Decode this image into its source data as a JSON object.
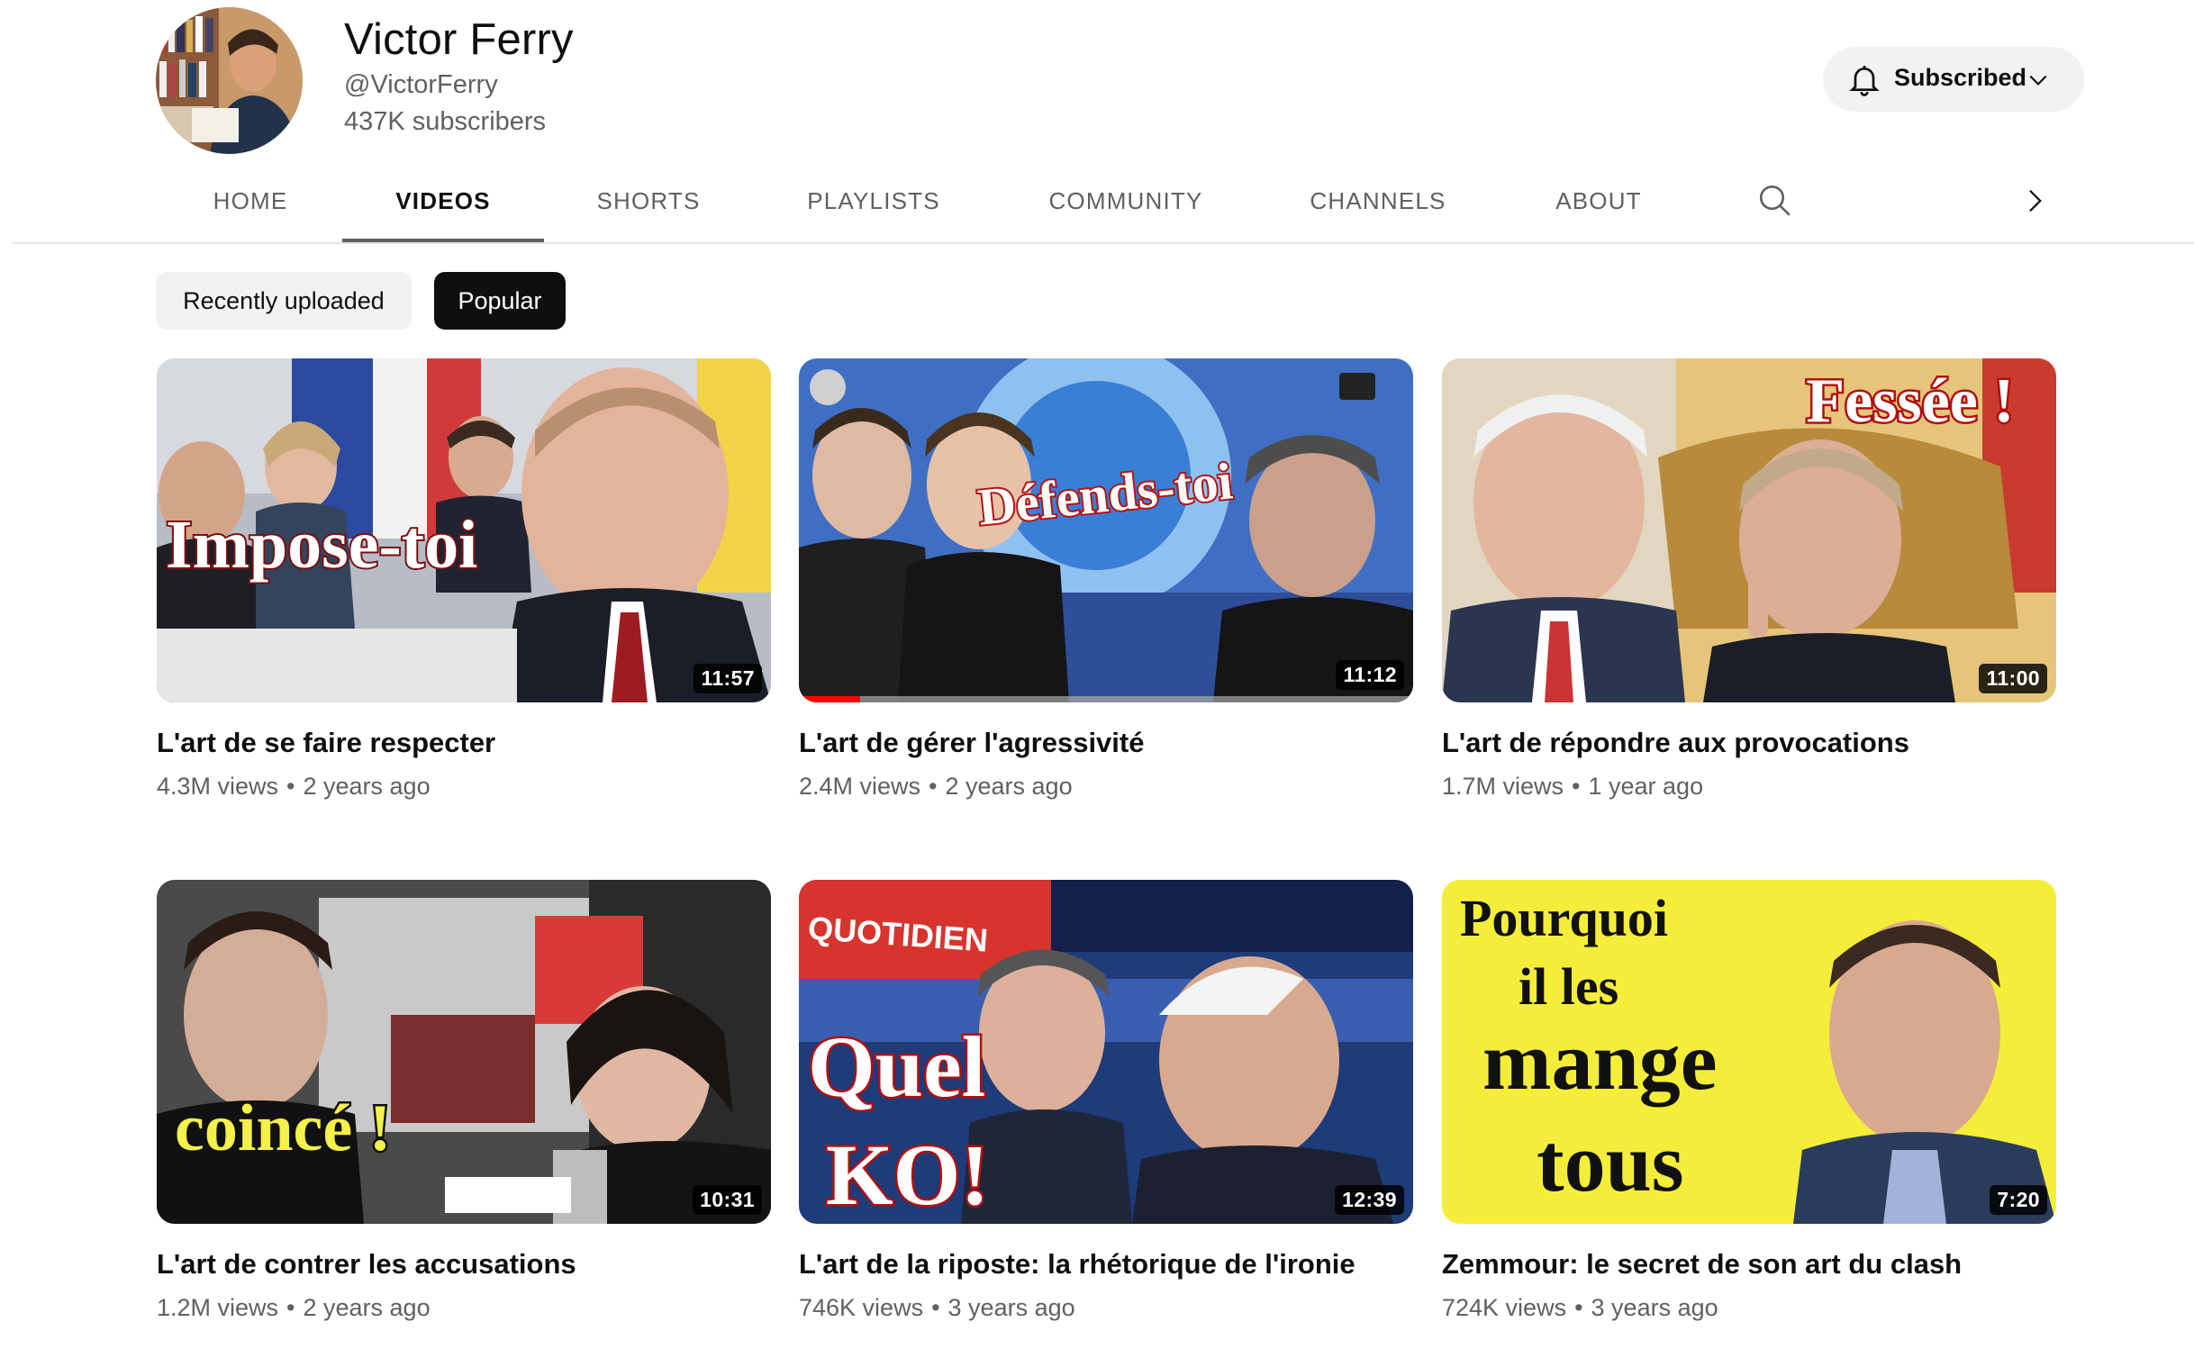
{
  "channel": {
    "name": "Victor Ferry",
    "handle": "@VictorFerry",
    "subscribers": "437K subscribers",
    "subscribe_label": "Subscribed"
  },
  "tabs": [
    {
      "label": "HOME",
      "active": false
    },
    {
      "label": "VIDEOS",
      "active": true
    },
    {
      "label": "SHORTS",
      "active": false
    },
    {
      "label": "PLAYLISTS",
      "active": false
    },
    {
      "label": "COMMUNITY",
      "active": false
    },
    {
      "label": "CHANNELS",
      "active": false
    },
    {
      "label": "ABOUT",
      "active": false
    }
  ],
  "icons": {
    "bell": "bell-icon",
    "chevron": "chevron-down-icon",
    "search": "search-icon",
    "next": "chevron-right-icon"
  },
  "chips": [
    {
      "label": "Recently uploaded",
      "active": false
    },
    {
      "label": "Popular",
      "active": true
    }
  ],
  "videos": [
    {
      "title": "L'art de se faire respecter",
      "views": "4.3M views",
      "age": "2 years ago",
      "duration": "11:57",
      "thumb_text": [
        "Impose-toi"
      ],
      "progress": 0
    },
    {
      "title": "L'art de gérer l'agressivité",
      "views": "2.4M views",
      "age": "2 years ago",
      "duration": "11:12",
      "thumb_text": [
        "Défends-toi"
      ],
      "progress": 0.1
    },
    {
      "title": "L'art de répondre aux provocations",
      "views": "1.7M views",
      "age": "1 year ago",
      "duration": "11:00",
      "thumb_text": [
        "Fessée !"
      ],
      "progress": 0
    },
    {
      "title": "L'art de contrer les accusations",
      "views": "1.2M views",
      "age": "2 years ago",
      "duration": "10:31",
      "thumb_text": [
        "coincé !"
      ],
      "progress": 0
    },
    {
      "title": "L'art de la riposte: la rhétorique de l'ironie",
      "views": "746K views",
      "age": "3 years ago",
      "duration": "12:39",
      "thumb_text": [
        "QUOTIDIEN",
        "Quel",
        "KO!"
      ],
      "progress": 0
    },
    {
      "title": "Zemmour: le secret de son art du clash",
      "views": "724K views",
      "age": "3 years ago",
      "duration": "7:20",
      "thumb_text": [
        "Pourquoi",
        "il les",
        "mange",
        "tous"
      ],
      "progress": 0
    }
  ],
  "meta_separator": "•",
  "colors": {
    "primary_text": "#0f0f0f",
    "secondary_text": "#606060",
    "chip_bg": "#f2f2f2",
    "progress": "#ff0000"
  }
}
